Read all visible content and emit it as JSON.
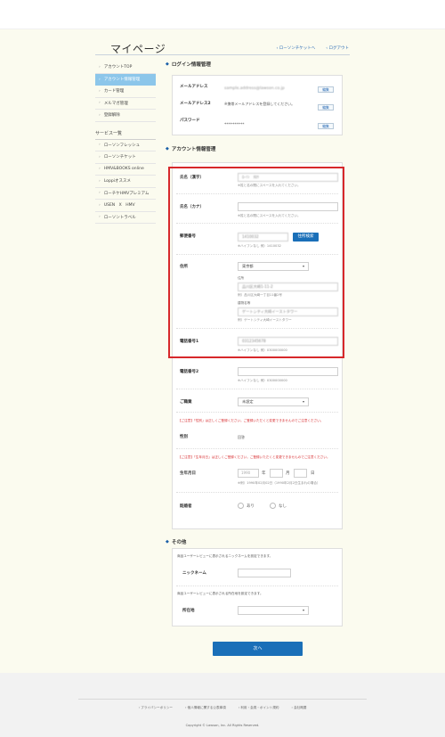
{
  "header": {
    "title": "マイページ",
    "links": [
      "ローソンチケットへ",
      "ログアウト"
    ]
  },
  "sidebar": {
    "items": [
      "アカウントTOP",
      "アカウント情報管理",
      "カード管理",
      "メルマガ管理",
      "登録解除"
    ],
    "service_head": "サービス一覧",
    "services": [
      "ローソンフレッシュ",
      "ローソンチケット",
      "HMV&BOOKS online",
      "Loppiオススメ",
      "ローチケHMVプレミアム",
      "USEN　X　HMV",
      "ローソントラベル"
    ]
  },
  "login_section": {
    "title": "ログイン情報管理",
    "email_label": "メールアドレス",
    "email_value": "sample.address@lawson.co.jp",
    "email2_label": "メールアドレス2",
    "email2_value": "※携帯メールアドレスを登録してください。",
    "password_label": "パスワード",
    "password_value": "**********",
    "edit_label": "編集"
  },
  "account_section": {
    "title": "アカウント情報管理",
    "name_kanji_label": "氏名（漢字）",
    "name_kanji_value": "ﾛｰｿﾝ　ﾀﾛｳ",
    "name_hint": "※姓と名の間にスペースを入れてください。",
    "name_kana_label": "氏名（カナ）",
    "name_kana_value": "",
    "postal_label": "郵便番号",
    "postal_value": "1410032",
    "postal_button": "住所検索",
    "postal_hint": "※ハイフンなし 例）1410032",
    "address_label": "住所",
    "prefecture_value": "東京都",
    "address_sub1": "住所",
    "address_value1": "品川区大崎1-11-2",
    "address_hint1": "例）品川区大崎一丁目11番2号",
    "address_sub2": "建物名等",
    "address_value2": "ゲートシティ大崎イーストタワー",
    "address_hint2": "例）ゲートシティ大崎イーストタワー",
    "phone1_label": "電話番号1",
    "phone1_value": "0312345678",
    "phone_hint": "※ハイフンなし 例）0300000000",
    "phone2_label": "電話番号2",
    "phone2_value": "",
    "job_label": "ご職業",
    "job_value": "未設定",
    "notice_gender": "【ご注意】「性別」は正しくご登録ください。ご登録いただくと変更できませんのでご注意ください。",
    "gender_label": "性別",
    "gender_value": "回答",
    "notice_birth": "【ご注意】「生年月日」は正しくご登録ください。ご登録いただくと変更できませんのでご注意ください。",
    "birth_label": "生年月日",
    "birth_year_placeholder": "1990",
    "birth_year_unit": "年",
    "birth_month_unit": "月",
    "birth_day_unit": "日",
    "birth_hint": "※例）1990年02月02日（1990年2月2日生まれの場合）",
    "marriage_label": "既婚者",
    "marriage_yes": "あり",
    "marriage_no": "なし"
  },
  "other_section": {
    "title": "その他",
    "nickname_desc": "商品ユーザーレビューに表示されるニックネームを設定できます。",
    "nickname_label": "ニックネーム",
    "pref_desc": "商品ユーザーレビューに表示される所在地を設定できます。",
    "pref_label": "所在地",
    "next_button": "次へ"
  },
  "footer": {
    "links": [
      "プライバシーポリシー",
      "個人情報に関する公表事項",
      "利用・会員・ポイント規約",
      "会社概要"
    ],
    "copyright": "Copyright © Lawson, Inc. All Rights Reserved."
  }
}
